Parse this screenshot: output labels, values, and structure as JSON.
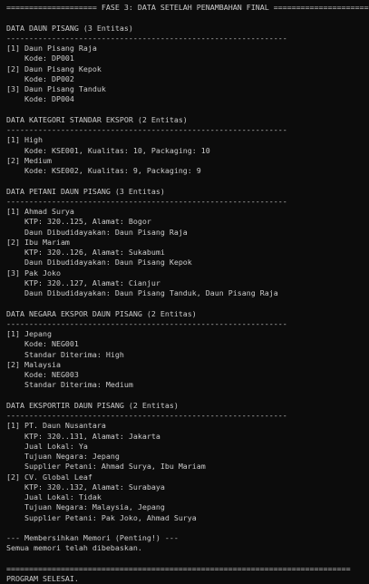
{
  "terminal": {
    "lines": [
      "==================== FASE 3: DATA SETELAH PENAMBAHAN FINAL =====================",
      "",
      "DATA DAUN PISANG (3 Entitas)",
      "--------------------------------------------------------------",
      "[1] Daun Pisang Raja",
      "    Kode: DP001",
      "[2] Daun Pisang Kepok",
      "    Kode: DP002",
      "[3] Daun Pisang Tanduk",
      "    Kode: DP004",
      "",
      "DATA KATEGORI STANDAR EKSPOR (2 Entitas)",
      "--------------------------------------------------------------",
      "[1] High",
      "    Kode: KSE001, Kualitas: 10, Packaging: 10",
      "[2] Medium",
      "    Kode: KSE002, Kualitas: 9, Packaging: 9",
      "",
      "DATA PETANI DAUN PISANG (3 Entitas)",
      "--------------------------------------------------------------",
      "[1] Ahmad Surya",
      "    KTP: 320..125, Alamat: Bogor",
      "    Daun Dibudidayakan: Daun Pisang Raja",
      "[2] Ibu Mariam",
      "    KTP: 320..126, Alamat: Sukabumi",
      "    Daun Dibudidayakan: Daun Pisang Kepok",
      "[3] Pak Joko",
      "    KTP: 320..127, Alamat: Cianjur",
      "    Daun Dibudidayakan: Daun Pisang Tanduk, Daun Pisang Raja",
      "",
      "DATA NEGARA EKSPOR DAUN PISANG (2 Entitas)",
      "--------------------------------------------------------------",
      "[1] Jepang",
      "    Kode: NEG001",
      "    Standar Diterima: High",
      "[2] Malaysia",
      "    Kode: NEG003",
      "    Standar Diterima: Medium",
      "",
      "DATA EKSPORTIR DAUN PISANG (2 Entitas)",
      "--------------------------------------------------------------",
      "[1] PT. Daun Nusantara",
      "    KTP: 320..131, Alamat: Jakarta",
      "    Jual Lokal: Ya",
      "    Tujuan Negara: Jepang",
      "    Supplier Petani: Ahmad Surya, Ibu Mariam",
      "[2] CV. Global Leaf",
      "    KTP: 320..132, Alamat: Surabaya",
      "    Jual Lokal: Tidak",
      "    Tujuan Negara: Malaysia, Jepang",
      "    Supplier Petani: Pak Joko, Ahmad Surya",
      "",
      "--- Membersihkan Memori (Penting!) ---",
      "Semua memori telah dibebaskan.",
      "",
      "============================================================================",
      "PROGRAM SELESAI."
    ]
  }
}
